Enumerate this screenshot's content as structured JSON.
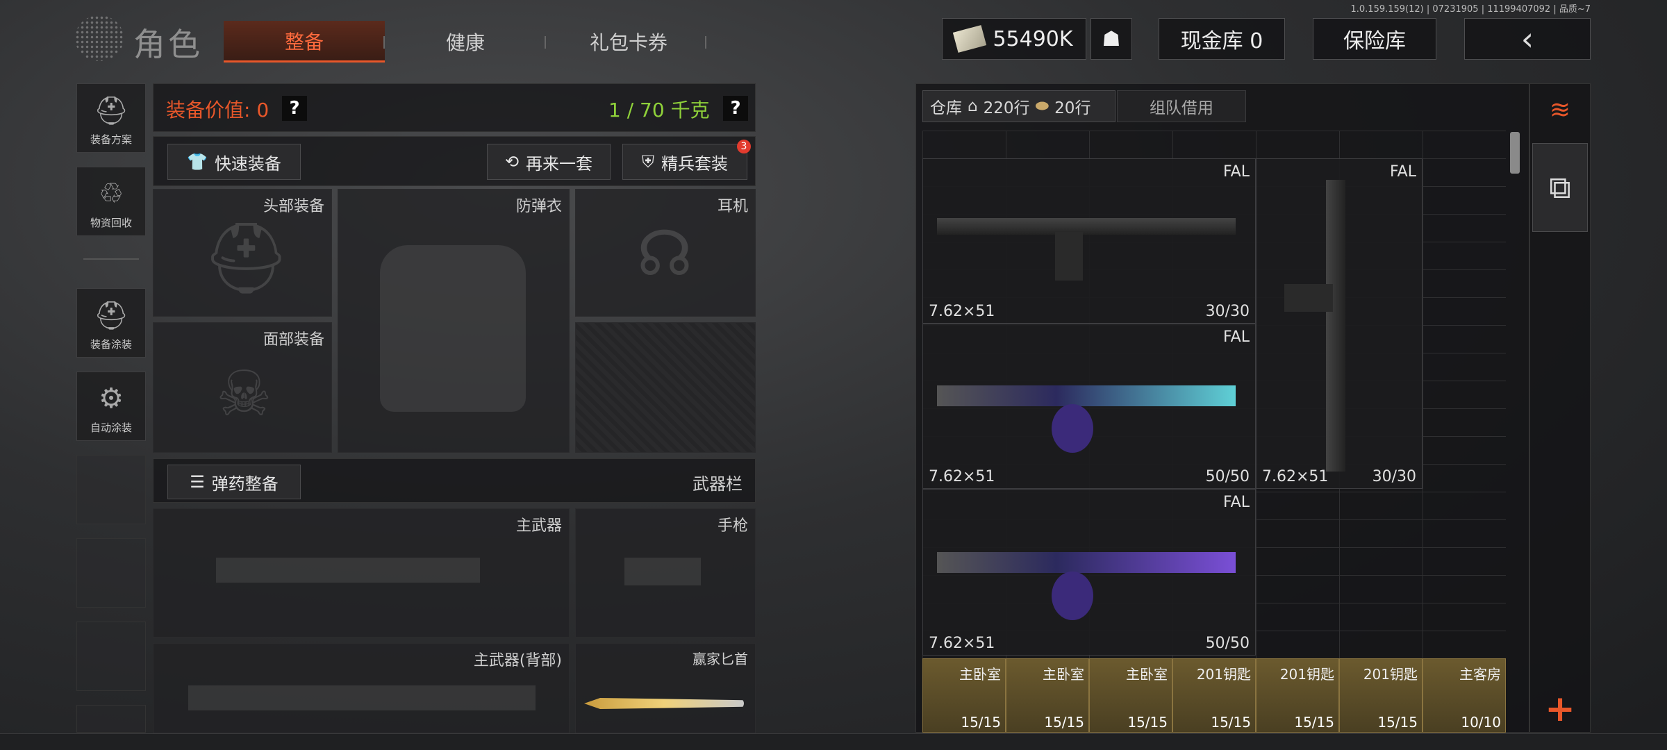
{
  "version": "1.0.159.159(12) | 07231905 | 11199407092 | 品质~7",
  "header": {
    "title": "角色",
    "tabs": [
      "整备",
      "健康",
      "礼包卡券"
    ],
    "money": "55490K",
    "cash_vault": "现金库 0",
    "safe": "保险库"
  },
  "sidebar": [
    "装备方案",
    "物资回收",
    "装备涂装",
    "自动涂装"
  ],
  "loadout": {
    "value_label": "装备价值: 0",
    "weight": "1 / 70 千克",
    "quick_equip": "快速装备",
    "again": "再来一套",
    "elite": "精兵套装",
    "elite_badge": "3",
    "slots": {
      "head": "头部装备",
      "armor": "防弹衣",
      "headset": "耳机",
      "face": "面部装备",
      "ammo": "弹药整备",
      "weapon_bar": "武器栏",
      "primary": "主武器",
      "pistol": "手枪",
      "primary_back": "主武器(背部)",
      "knife": "赢家匕首"
    }
  },
  "warehouse": {
    "tab_label": "仓库",
    "rows": "220行",
    "rows2": "20行",
    "team_borrow": "组队借用",
    "items": [
      {
        "name": "FAL",
        "caliber": "7.62×51",
        "count": "30/30"
      },
      {
        "name": "FAL",
        "caliber": "7.62×51",
        "count": "30/30"
      },
      {
        "name": "FAL",
        "caliber": "7.62×51",
        "count": "50/50"
      },
      {
        "name": "FAL",
        "caliber": "7.62×51",
        "count": "50/50"
      }
    ],
    "keys": [
      {
        "name": "主卧室",
        "count": "15/15"
      },
      {
        "name": "主卧室",
        "count": "15/15"
      },
      {
        "name": "主卧室",
        "count": "15/15"
      },
      {
        "name": "201钥匙",
        "count": "15/15"
      },
      {
        "name": "201钥匙",
        "count": "15/15"
      },
      {
        "name": "201钥匙",
        "count": "15/15"
      },
      {
        "name": "主客房",
        "count": "10/10"
      }
    ]
  },
  "colors": {
    "accent": "#e8572a",
    "weight": "#8fd13a"
  }
}
